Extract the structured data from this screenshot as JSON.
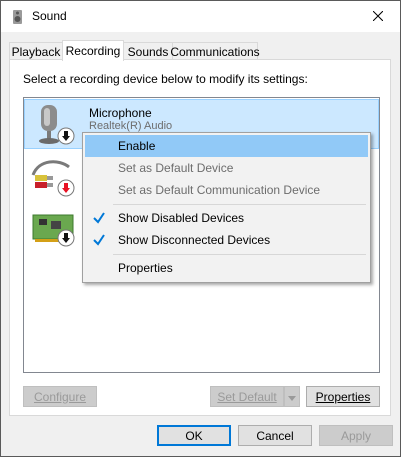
{
  "window": {
    "title": "Sound"
  },
  "tabs": [
    {
      "label": "Playback"
    },
    {
      "label": "Recording"
    },
    {
      "label": "Sounds"
    },
    {
      "label": "Communications"
    }
  ],
  "panel": {
    "instructions": "Select a recording device below to modify its settings:"
  },
  "devices": [
    {
      "name": "Microphone",
      "description": "Realtek(R) Audio",
      "icon": "microphone-icon",
      "status_icon": "disabled-arrow-icon",
      "selected": true
    },
    {
      "name": "",
      "description": "",
      "icon": "line-in-cable-icon",
      "status_icon": "disconnected-arrow-icon",
      "selected": false
    },
    {
      "name": "",
      "description": "",
      "icon": "circuit-board-icon",
      "status_icon": "disabled-arrow-icon",
      "selected": false
    }
  ],
  "context_menu": {
    "items": [
      {
        "label": "Enable",
        "state": "hover"
      },
      {
        "label": "Set as Default Device",
        "state": "disabled"
      },
      {
        "label": "Set as Default Communication Device",
        "state": "disabled"
      },
      {
        "label": "Show Disabled Devices",
        "checked": true
      },
      {
        "label": "Show Disconnected Devices",
        "checked": true
      },
      {
        "label": "Properties"
      }
    ]
  },
  "panel_buttons": {
    "configure": "Configure",
    "set_default": "Set Default",
    "properties": "Properties"
  },
  "dialog_buttons": {
    "ok": "OK",
    "cancel": "Cancel",
    "apply": "Apply"
  },
  "colors": {
    "selection": "#cce8ff",
    "menu_hover": "#91c9f7",
    "check": "#0078d7",
    "status_arrow_red": "#e81123"
  }
}
